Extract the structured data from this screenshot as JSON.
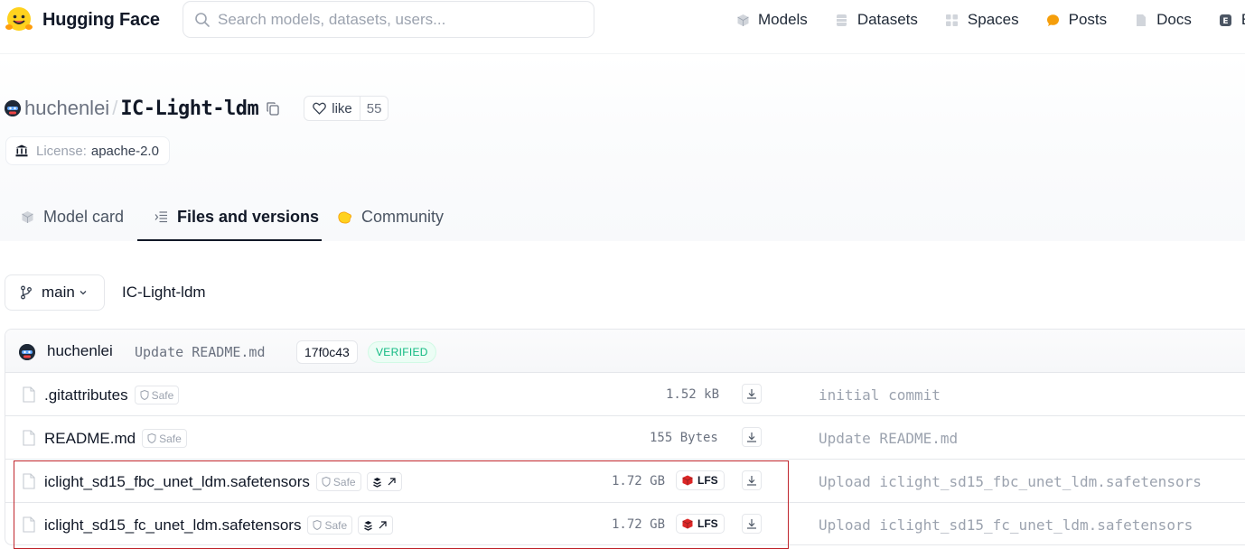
{
  "navbar": {
    "brand": "Hugging Face",
    "search_placeholder": "Search models, datasets, users...",
    "links": [
      {
        "label": "Models",
        "icon": "cube-icon"
      },
      {
        "label": "Datasets",
        "icon": "database-icon"
      },
      {
        "label": "Spaces",
        "icon": "grid-icon"
      },
      {
        "label": "Posts",
        "icon": "chat-bubble-icon"
      },
      {
        "label": "Docs",
        "icon": "doc-icon"
      },
      {
        "label": "E",
        "icon": "enterprise-icon"
      }
    ]
  },
  "repo": {
    "owner": "huchenlei",
    "separator": "/",
    "name": "IC-Light-ldm",
    "like_label": "like",
    "like_count": "55",
    "license_label": "License:",
    "license_value": "apache-2.0"
  },
  "tabs": [
    {
      "label": "Model card",
      "icon": "cube-icon",
      "active": false
    },
    {
      "label": "Files and versions",
      "icon": "files-icon",
      "active": true
    },
    {
      "label": "Community",
      "icon": "community-icon",
      "active": false
    }
  ],
  "branch": {
    "name": "main",
    "path": "IC-Light-ldm"
  },
  "last_commit": {
    "user": "huchenlei",
    "message": "Update README.md",
    "hash": "17f0c43",
    "status": "VERIFIED"
  },
  "files": [
    {
      "name": ".gitattributes",
      "safe": "Safe",
      "size": "1.52 kB",
      "lfs": false,
      "stack": false,
      "commit": "initial commit"
    },
    {
      "name": "README.md",
      "safe": "Safe",
      "size": "155 Bytes",
      "lfs": false,
      "stack": false,
      "commit": "Update README.md"
    },
    {
      "name": "iclight_sd15_fbc_unet_ldm.safetensors",
      "safe": "Safe",
      "size": "1.72 GB",
      "lfs": true,
      "lfs_label": "LFS",
      "stack": true,
      "commit": "Upload iclight_sd15_fbc_unet_ldm.safetensors"
    },
    {
      "name": "iclight_sd15_fc_unet_ldm.safetensors",
      "safe": "Safe",
      "size": "1.72 GB",
      "lfs": true,
      "lfs_label": "LFS",
      "stack": true,
      "commit": "Upload iclight_sd15_fc_unet_ldm.safetensors"
    }
  ],
  "colors": {
    "highlight_box": "#c0262d",
    "verified_text": "#10b981",
    "lfs_icon": "#dc2626",
    "posts_icon": "#f59e0b"
  }
}
